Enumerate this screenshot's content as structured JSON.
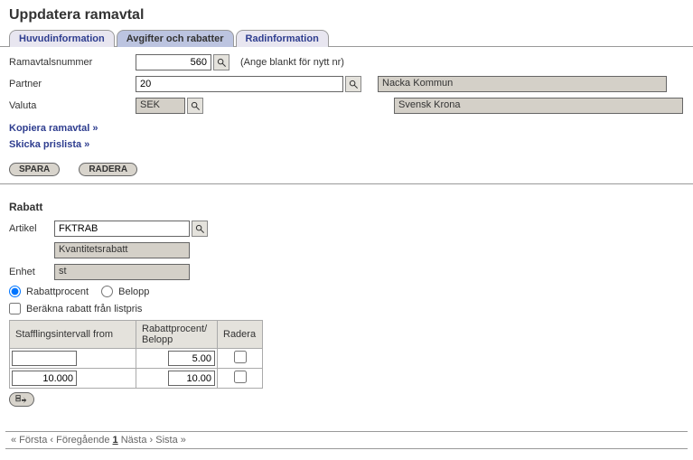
{
  "page_title": "Uppdatera ramavtal",
  "tabs": [
    {
      "label": "Huvudinformation"
    },
    {
      "label": "Avgifter och rabatter"
    },
    {
      "label": "Radinformation"
    }
  ],
  "form": {
    "ramavtal_label": "Ramavtalsnummer",
    "ramavtal_value": "560",
    "ramavtal_hint": "(Ange blankt för nytt nr)",
    "partner_label": "Partner",
    "partner_value": "20",
    "partner_display": "Nacka Kommun",
    "valuta_label": "Valuta",
    "valuta_value": "SEK",
    "valuta_display": "Svensk Krona"
  },
  "links": {
    "copy": "Kopiera ramavtal »",
    "send": "Skicka prislista »"
  },
  "buttons": {
    "save": "SPARA",
    "delete": "RADERA"
  },
  "rabatt": {
    "title": "Rabatt",
    "artikel_label": "Artikel",
    "artikel_value": "FKTRAB",
    "artikel_display": "Kvantitetsrabatt",
    "enhet_label": "Enhet",
    "enhet_value": "st",
    "radio_percent": "Rabattprocent",
    "radio_amount": "Belopp",
    "checkbox_listpris": "Beräkna rabatt från listpris"
  },
  "table": {
    "col_interval": "Stafflingsintervall from",
    "col_percent": "Rabattprocent/ Belopp",
    "col_delete": "Radera",
    "rows": [
      {
        "from": "",
        "pct": "5.00"
      },
      {
        "from": "10.000",
        "pct": "10.00"
      }
    ]
  },
  "pager": {
    "first": "« Första",
    "prev": "‹ Föregående",
    "current": "1",
    "next": "Nästa ›",
    "last": "Sista »"
  }
}
